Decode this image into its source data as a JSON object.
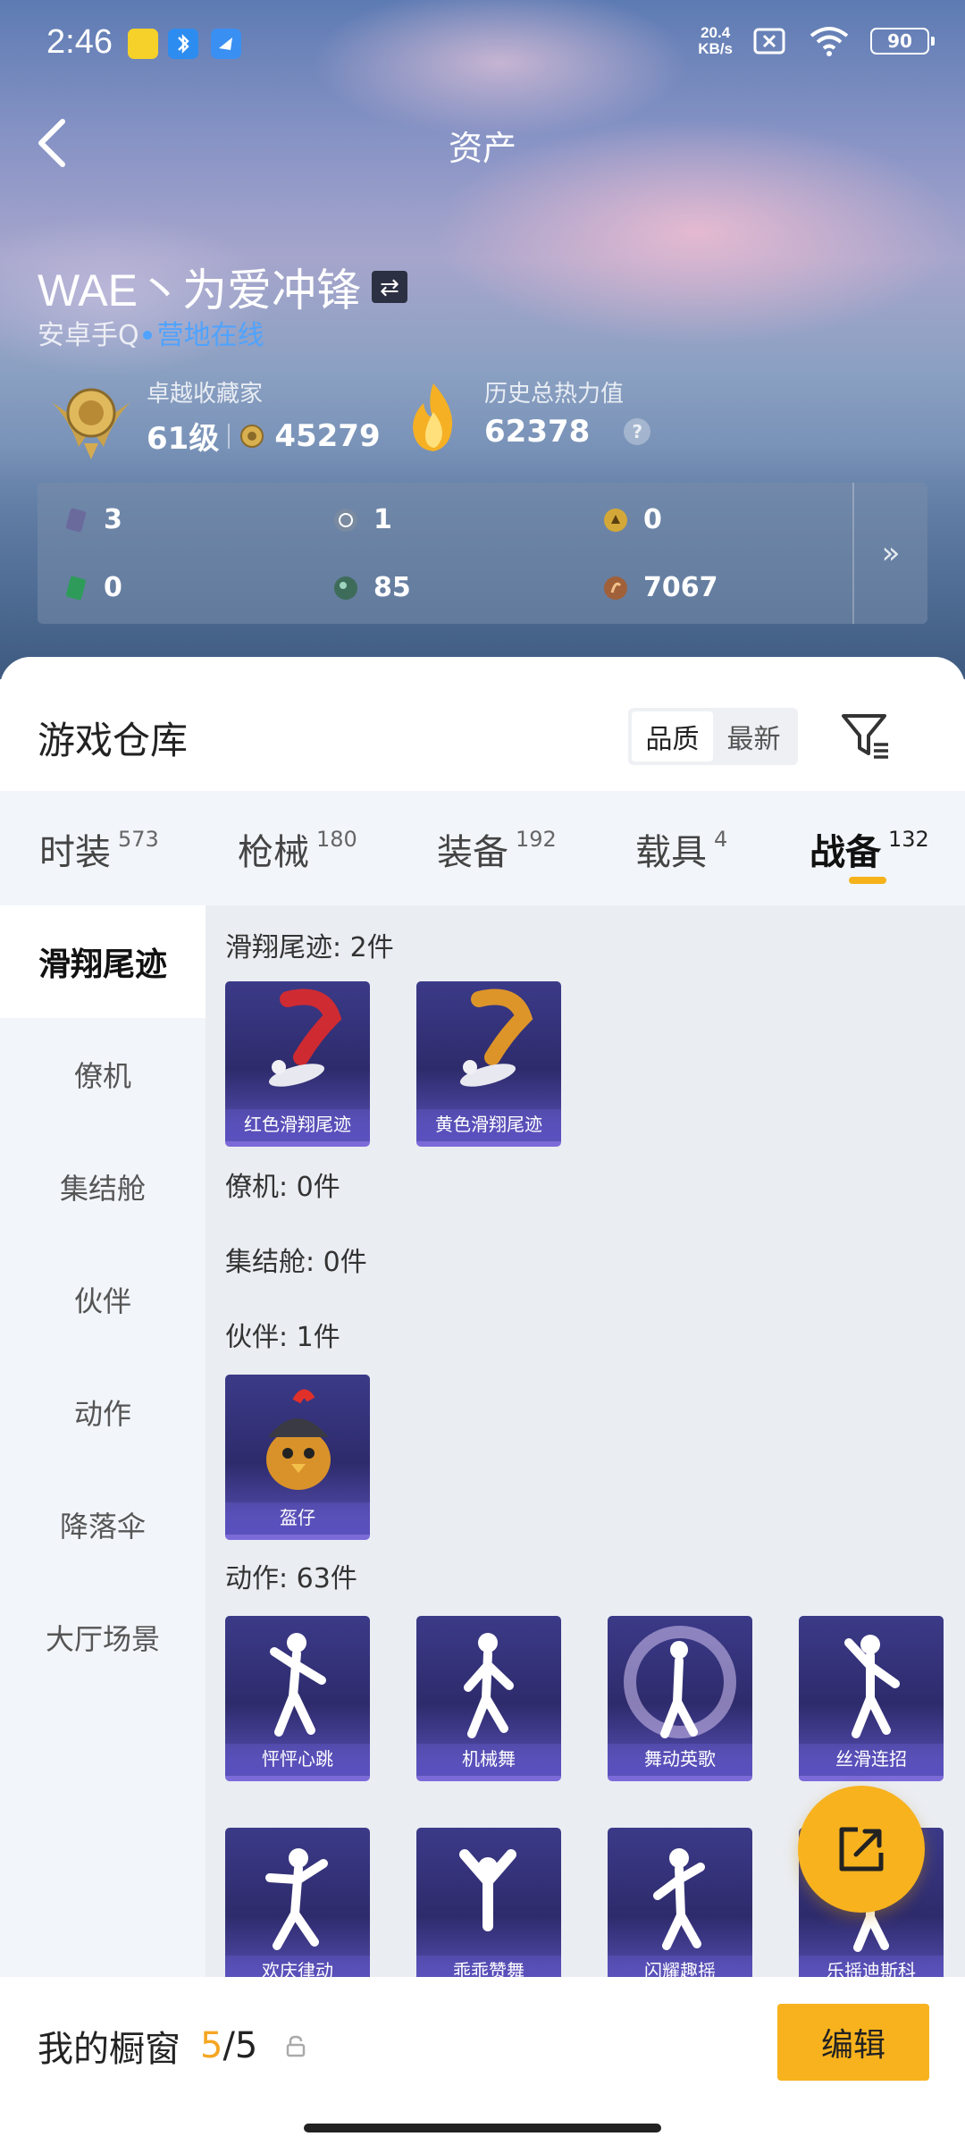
{
  "status": {
    "time": "2:46",
    "speed_value": "20.4",
    "speed_unit": "KB/s",
    "battery": "90"
  },
  "header": {
    "title": "资产"
  },
  "profile": {
    "name": "WAE丶为爱冲锋",
    "swap_symbol": "⇄",
    "platform": "安卓手Q",
    "online_status": "营地在线",
    "collector_label": "卓越收藏家",
    "collector_level": "61级",
    "collector_points": "45279",
    "heat_label": "历史总热力值",
    "heat_value": "62378",
    "help_symbol": "?"
  },
  "currencies": [
    {
      "value": "3",
      "color": "#6a6a9c"
    },
    {
      "value": "1",
      "color": "#7a8aa0"
    },
    {
      "value": "0",
      "color": "#d4a838"
    },
    {
      "value": "0",
      "color": "#2f9b5b"
    },
    {
      "value": "85",
      "color": "#3e6c5a"
    },
    {
      "value": "7067",
      "color": "#a0603a"
    }
  ],
  "currency_more": "»",
  "warehouse": {
    "title": "游戏仓库",
    "sort_options": [
      "品质",
      "最新"
    ],
    "tabs": [
      {
        "label": "时装",
        "count": "573"
      },
      {
        "label": "枪械",
        "count": "180"
      },
      {
        "label": "装备",
        "count": "192"
      },
      {
        "label": "载具",
        "count": "4"
      },
      {
        "label": "战备",
        "count": "132"
      }
    ],
    "sidebar": [
      "滑翔尾迹",
      "僚机",
      "集结舱",
      "伙伴",
      "动作",
      "降落伞",
      "大厅场景"
    ],
    "sections": {
      "glide_title": "滑翔尾迹: 2件",
      "glide_items": [
        "红色滑翔尾迹",
        "黄色滑翔尾迹"
      ],
      "wingman_title": "僚机: 0件",
      "capsule_title": "集结舱: 0件",
      "partner_title": "伙伴: 1件",
      "partner_items": [
        "盔仔"
      ],
      "emote_title": "动作: 63件",
      "emote_items_row1": [
        "怦怦心跳",
        "机械舞",
        "舞动英歌",
        "丝滑连招"
      ],
      "emote_items_row2": [
        "欢庆律动",
        "乖乖赞舞",
        "闪耀趣摇",
        "乐摇迪斯科"
      ]
    }
  },
  "showcase": {
    "label": "我的橱窗",
    "current": "5",
    "total": "/5",
    "edit_label": "编辑"
  },
  "colors": {
    "accent": "#f7b21e",
    "online": "#4fa3ff",
    "card_bg": "#2e2b6c"
  }
}
